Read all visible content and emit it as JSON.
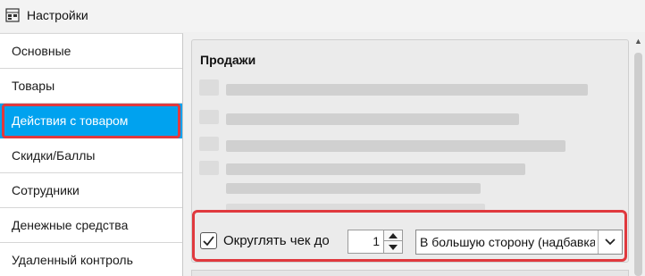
{
  "window": {
    "title": "Настройки",
    "icon": "settings-app-icon"
  },
  "sidebar": {
    "items": [
      {
        "label": "Основные",
        "active": false
      },
      {
        "label": "Товары",
        "active": false
      },
      {
        "label": "Действия с товаром",
        "active": true
      },
      {
        "label": "Скидки/Баллы",
        "active": false
      },
      {
        "label": "Сотрудники",
        "active": false
      },
      {
        "label": "Денежные средства",
        "active": false
      },
      {
        "label": "Удаленный контроль",
        "active": false
      }
    ]
  },
  "main": {
    "section_title": "Продажи",
    "round_check": {
      "checked": true,
      "label": "Округлять чек до",
      "value": "1",
      "direction_selected": "В большую сторону (надбавка)"
    }
  },
  "colors": {
    "accent": "#00a2ef",
    "highlight": "#e0393e"
  }
}
